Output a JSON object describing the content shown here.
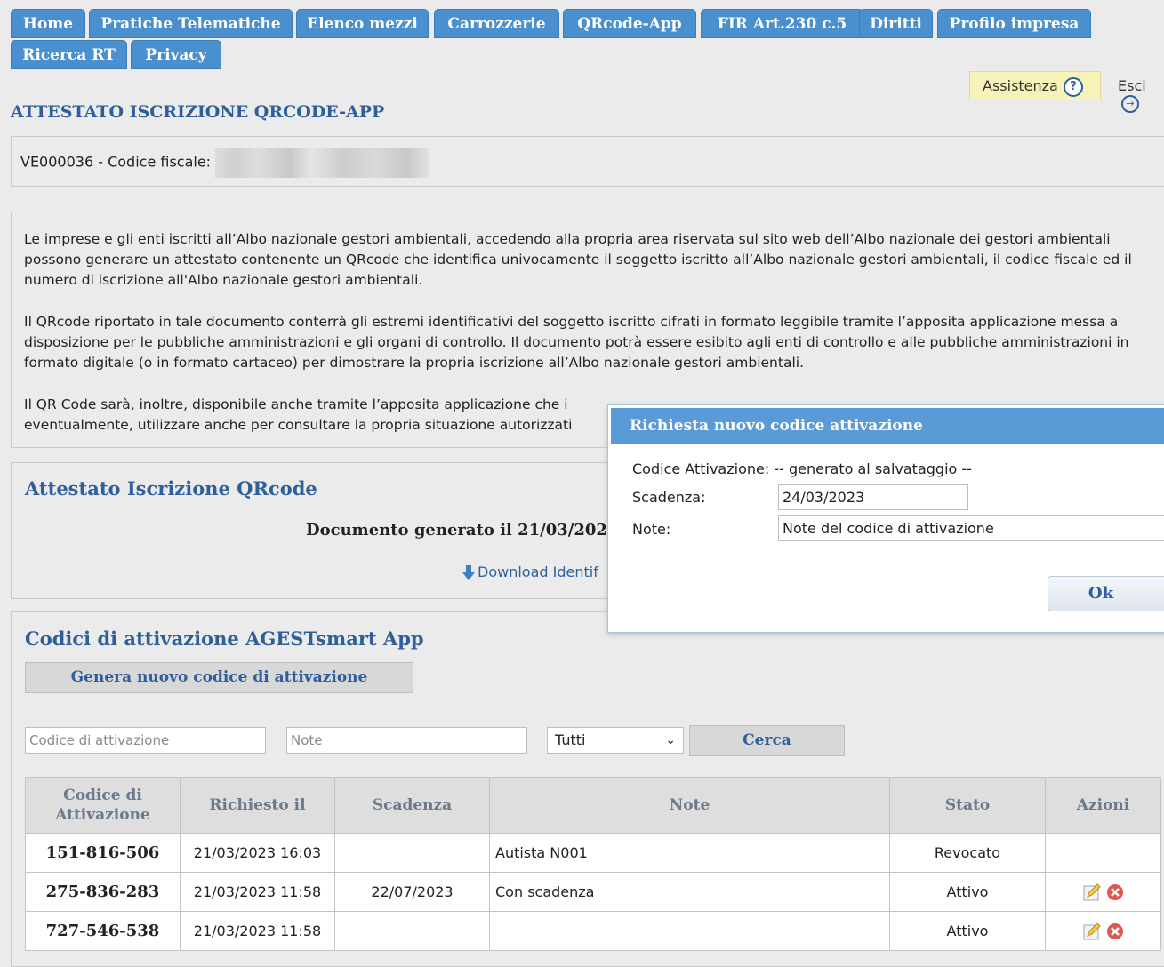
{
  "nav": {
    "tabs": [
      "Home",
      "Pratiche Telematiche",
      "Elenco mezzi",
      "Carrozzerie",
      "QRcode-App",
      "FIR Art.230 c.5",
      "Diritti",
      "Profilo impresa",
      "Ricerca RT",
      "Privacy"
    ]
  },
  "header": {
    "assistenza_label": "Assistenza",
    "esci_label": "Esci",
    "page_title": "ATTESTATO ISCRIZIONE QRCODE-APP"
  },
  "company": {
    "id_label": "VE000036 - Codice fiscale:"
  },
  "info": {
    "p1": "Le imprese e gli enti iscritti all’Albo nazionale gestori ambientali, accedendo alla propria area riservata sul sito web dell’Albo nazionale dei gestori ambientali possono generare un attestato contenente un QRcode che identifica univocamente il soggetto iscritto all’Albo nazionale gestori ambientali, il codice fiscale ed il numero di iscrizione all'Albo nazionale gestori ambientali.",
    "p2": "Il QRcode riportato in tale documento conterrà gli estremi identificativi del soggetto iscritto cifrati in formato leggibile tramite l’apposita applicazione messa a disposizione per le pubbliche amministrazioni e gli organi di controllo. Il documento potrà essere esibito agli enti di controllo e alle pubbliche amministrazioni in formato digitale (o in formato cartaceo) per dimostrare la propria iscrizione all’Albo nazionale gestori ambientali.",
    "p3": "Il QR Code sarà, inoltre, disponibile anche tramite l’apposita applicazione che i",
    "p4": "eventualmente, utilizzare anche per consultare la propria situazione autorizzati"
  },
  "attestato": {
    "title": "Attestato Iscrizione QRcode",
    "generated": "Documento generato il 21/03/2023",
    "download": "Download Identif"
  },
  "codici": {
    "title": "Codici di attivazione AGESTsmart App",
    "generate_button": "Genera nuovo codice di attivazione",
    "filter_code_placeholder": "Codice di attivazione",
    "filter_note_placeholder": "Note",
    "filter_status_value": "Tutti",
    "search_button": "Cerca",
    "columns": [
      "Codice di Attivazione",
      "Richiesto il",
      "Scadenza",
      "Note",
      "Stato",
      "Azioni"
    ],
    "rows": [
      {
        "code": "151-816-506",
        "requested": "21/03/2023 16:03",
        "expiry": "",
        "note": "Autista N001",
        "status": "Revocato",
        "actions": false
      },
      {
        "code": "275-836-283",
        "requested": "21/03/2023 11:58",
        "expiry": "22/07/2023",
        "note": "Con scadenza",
        "status": "Attivo",
        "actions": true
      },
      {
        "code": "727-546-538",
        "requested": "21/03/2023 11:58",
        "expiry": "",
        "note": "",
        "status": "Attivo",
        "actions": true
      }
    ]
  },
  "dialog": {
    "title": "Richiesta nuovo codice attivazione",
    "code_label": "Codice Attivazione:",
    "code_value": "-- generato al salvataggio --",
    "expiry_label": "Scadenza:",
    "expiry_value": "24/03/2023",
    "note_label": "Note:",
    "note_value": "Note del codice di attivazione",
    "ok_button": "Ok"
  },
  "colors": {
    "nav_blue": "#4a8fce",
    "title_blue": "#2f5f9a",
    "dialog_header": "#5a9ad7"
  }
}
